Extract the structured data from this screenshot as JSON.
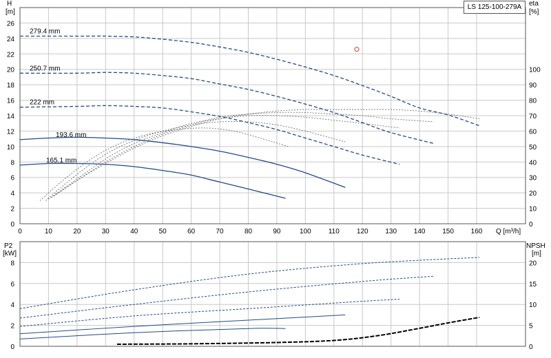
{
  "title": "LS 125-100-279A",
  "colors": {
    "head": "#1f4a8a",
    "eff": "#707070",
    "npsh": "#000000",
    "grid": "#c8c8c8",
    "marker": "#e03030"
  },
  "chart_data": [
    {
      "type": "line",
      "title": "LS 125-100-279A",
      "xlabel": "Q [m³/h]",
      "ylabel": "H [m]",
      "ylabel_top": "H",
      "ylabel_unit": "[m]",
      "y2label_top": "eta",
      "y2label_unit": "[%]",
      "xlim": [
        0,
        160
      ],
      "ylim": [
        0,
        28
      ],
      "y2lim": [
        0,
        140
      ],
      "xticks": [
        0,
        10,
        20,
        30,
        40,
        50,
        60,
        70,
        80,
        90,
        100,
        110,
        120,
        130,
        140,
        150,
        160
      ],
      "yticks": [
        0,
        2,
        4,
        6,
        8,
        10,
        12,
        14,
        16,
        18,
        20,
        22,
        24,
        26
      ],
      "y2ticks": [
        0,
        10,
        20,
        30,
        40,
        50,
        60,
        70,
        80,
        90,
        100
      ],
      "grid": true,
      "marker_point": {
        "x": 118,
        "y": 22.6
      },
      "head_curves": [
        {
          "name": "279.4 mm",
          "x": [
            0,
            20,
            30,
            40,
            50,
            60,
            70,
            80,
            90,
            100,
            110,
            120,
            130,
            140,
            150,
            161
          ],
          "y": [
            24.3,
            24.3,
            24.3,
            24.2,
            23.9,
            23.5,
            22.9,
            22.2,
            21.3,
            20.3,
            19.2,
            17.9,
            16.5,
            15.0,
            14.1,
            12.7
          ]
        },
        {
          "name": "250.7 mm",
          "x": [
            0,
            20,
            30,
            40,
            50,
            60,
            70,
            80,
            90,
            100,
            110,
            120,
            130,
            145
          ],
          "y": [
            19.5,
            19.5,
            19.6,
            19.5,
            19.2,
            18.8,
            18.1,
            17.4,
            16.5,
            15.5,
            14.4,
            13.1,
            11.8,
            10.4
          ]
        },
        {
          "name": "222 mm",
          "x": [
            0,
            20,
            30,
            40,
            50,
            60,
            70,
            80,
            90,
            100,
            110,
            120,
            133
          ],
          "y": [
            15.1,
            15.2,
            15.3,
            15.2,
            15.0,
            14.5,
            13.9,
            13.1,
            12.2,
            11.1,
            10.0,
            8.9,
            7.7
          ]
        },
        {
          "name": "193.6 mm",
          "x": [
            0,
            10,
            20,
            30,
            40,
            50,
            60,
            70,
            80,
            90,
            100,
            114
          ],
          "y": [
            10.9,
            11.1,
            11.2,
            11.1,
            10.9,
            10.5,
            10.0,
            9.4,
            8.6,
            7.7,
            6.6,
            4.7
          ]
        },
        {
          "name": "165.1 mm",
          "x": [
            0,
            10,
            20,
            30,
            40,
            50,
            60,
            70,
            80,
            93
          ],
          "y": [
            7.6,
            7.8,
            7.8,
            7.7,
            7.4,
            6.9,
            6.3,
            5.4,
            4.5,
            3.3
          ]
        }
      ],
      "efficiency_curves": [
        {
          "x": [
            7,
            15,
            25,
            35,
            45,
            55,
            65,
            75,
            85,
            94
          ],
          "y": [
            15,
            28,
            42,
            52,
            58,
            61,
            62,
            60,
            55,
            50
          ]
        },
        {
          "x": [
            9,
            20,
            30,
            40,
            50,
            60,
            70,
            80,
            90,
            100,
            114
          ],
          "y": [
            15,
            32,
            45,
            54,
            60,
            64,
            66,
            66,
            64,
            60,
            53
          ]
        },
        {
          "x": [
            10,
            20,
            30,
            40,
            50,
            60,
            70,
            80,
            90,
            100,
            110,
            120,
            133
          ],
          "y": [
            16,
            29,
            42,
            52,
            59,
            65,
            68,
            70,
            70,
            69,
            67,
            65,
            62
          ]
        },
        {
          "x": [
            11,
            20,
            30,
            40,
            50,
            60,
            70,
            80,
            90,
            100,
            110,
            120,
            130,
            145
          ],
          "y": [
            17,
            28,
            40,
            50,
            58,
            64,
            69,
            71,
            72,
            72,
            71,
            70,
            68,
            66
          ]
        },
        {
          "x": [
            12,
            20,
            30,
            40,
            50,
            60,
            70,
            80,
            90,
            100,
            110,
            120,
            130,
            140,
            150,
            161
          ],
          "y": [
            18,
            28,
            39,
            49,
            57,
            63,
            68,
            71,
            73,
            74,
            74,
            74,
            74,
            73,
            71,
            68
          ]
        }
      ]
    },
    {
      "type": "line",
      "xlabel": "",
      "ylabel_top": "P2",
      "ylabel_unit": "[kW]",
      "y2label_top": "NPSH",
      "y2label_unit": "[m]",
      "xlim": [
        0,
        160
      ],
      "ylim": [
        0,
        10
      ],
      "y2lim": [
        0,
        25
      ],
      "yticks": [
        0,
        2,
        4,
        6,
        8
      ],
      "y2ticks": [
        0,
        5,
        10,
        15,
        20
      ],
      "grid": true,
      "power_curves": [
        {
          "x": [
            0,
            40,
            80,
            120,
            161
          ],
          "y": [
            3.6,
            5.4,
            6.9,
            7.9,
            8.5
          ]
        },
        {
          "x": [
            0,
            40,
            80,
            120,
            145
          ],
          "y": [
            2.7,
            4.0,
            5.2,
            6.2,
            6.7
          ]
        },
        {
          "x": [
            0,
            40,
            80,
            120,
            133
          ],
          "y": [
            1.9,
            2.9,
            3.6,
            4.3,
            4.5
          ]
        },
        {
          "x": [
            0,
            40,
            80,
            114
          ],
          "y": [
            1.2,
            1.9,
            2.5,
            3.0
          ]
        },
        {
          "x": [
            0,
            40,
            80,
            93
          ],
          "y": [
            0.7,
            1.3,
            1.7,
            1.7
          ]
        }
      ],
      "npsh_curve": {
        "x": [
          34,
          60,
          90,
          110,
          125,
          140,
          150,
          161
        ],
        "y": [
          0.5,
          0.6,
          0.9,
          1.4,
          2.5,
          4.3,
          5.6,
          6.9
        ]
      }
    }
  ]
}
